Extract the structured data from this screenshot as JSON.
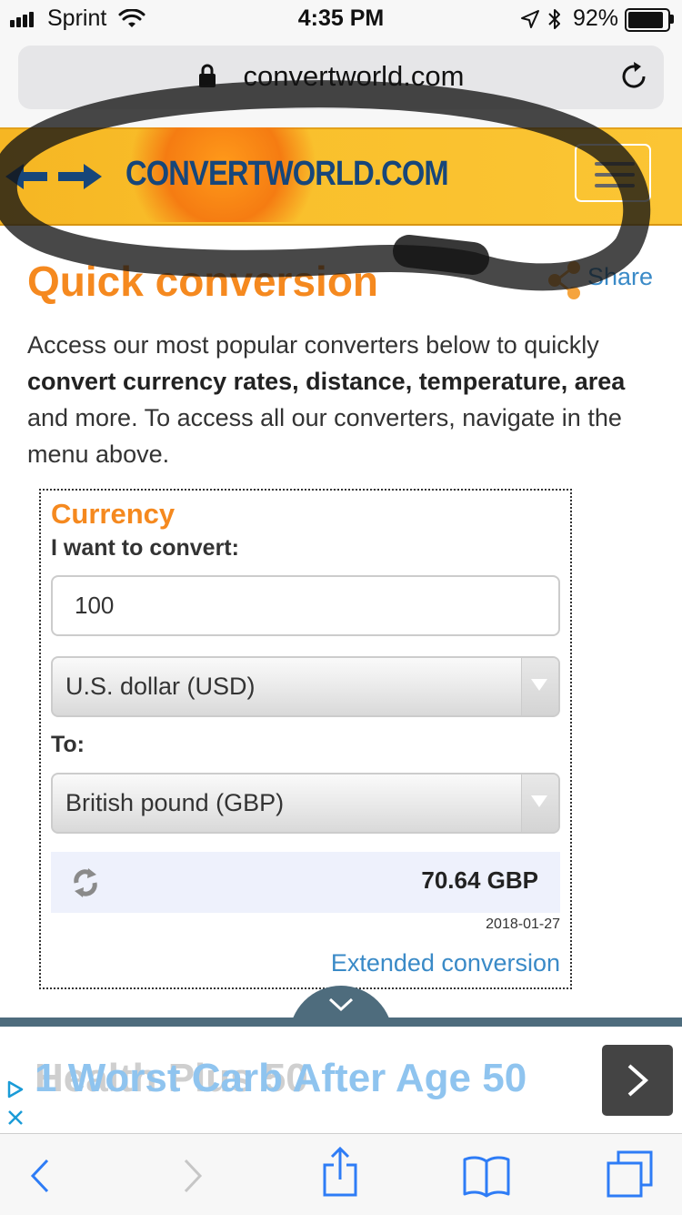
{
  "status_bar": {
    "carrier": "Sprint",
    "time": "4:35 PM",
    "battery": "92%"
  },
  "browser": {
    "url": "convertworld.com"
  },
  "site_header": {
    "logo": "CONVERTWORLD.COM",
    "menu_icon": "hamburger-icon"
  },
  "page": {
    "heading": "Quick conversion",
    "share": "Share",
    "intro_part1": "Access our most popular converters below to quickly ",
    "intro_bold": "convert currency rates, distance, temperature, area",
    "intro_part2": " and more. To access all our converters, navigate in the menu above."
  },
  "converter": {
    "title": "Currency",
    "convert_label": "I want to convert:",
    "amount": "100",
    "from_currency": "U.S. dollar (USD)",
    "to_label": "To:",
    "to_currency": "British pound (GBP)",
    "result": "70.64 GBP",
    "date": "2018-01-27",
    "extended_link": "Extended conversion"
  },
  "ad": {
    "headline": "1 Worst Carb After Age 50",
    "ghost_text": "Health Plus 50"
  },
  "colors": {
    "accent_orange": "#f5891f",
    "link_blue": "#3a8ac7",
    "header_yellow": "#f9c02c"
  }
}
